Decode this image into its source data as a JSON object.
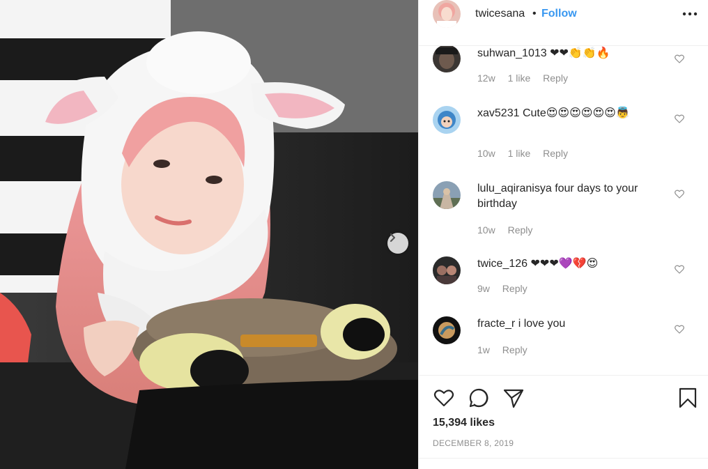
{
  "post": {
    "username": "twicesana",
    "separator": "•",
    "follow_label": "Follow",
    "likes": "15,394 likes",
    "date": "December 8, 2019"
  },
  "comments": [
    {
      "user": "suhwan_1013",
      "text": "❤❤👏👏🔥",
      "time": "12w",
      "likes": "1 like",
      "reply": "Reply"
    },
    {
      "user": "xav5231",
      "text": "Cute😍😍😍😍😍😍👼",
      "time": "10w",
      "likes": "1 like",
      "reply": "Reply"
    },
    {
      "user": "lulu_aqiranisya",
      "text": "four days to your birthday",
      "time": "10w",
      "likes": "",
      "reply": "Reply"
    },
    {
      "user": "twice_126",
      "text": "❤❤❤💜💔😍",
      "time": "9w",
      "likes": "",
      "reply": "Reply"
    },
    {
      "user": "fracte_r",
      "text": "i love you",
      "time": "1w",
      "likes": "",
      "reply": "Reply"
    }
  ],
  "icons": {
    "more": "more-options-icon",
    "like": "heart-icon",
    "comment": "comment-icon",
    "share": "share-icon",
    "save": "bookmark-icon",
    "next": "chevron-right-icon"
  },
  "colors": {
    "follow": "#3897f0",
    "meta": "#8e8e8e",
    "text": "#262626",
    "divider": "#efefef"
  }
}
